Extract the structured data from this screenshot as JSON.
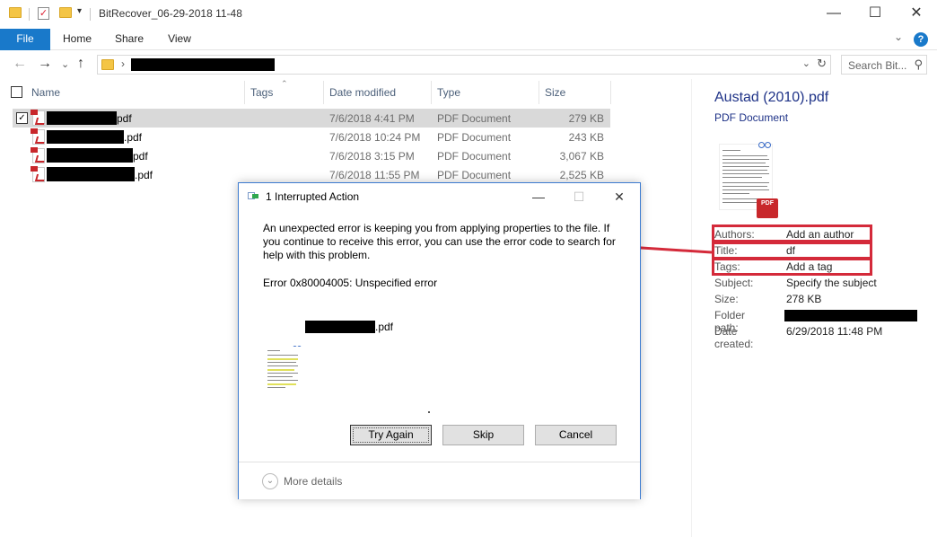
{
  "window": {
    "title": "BitRecover_06-29-2018 11-48",
    "minimize": "—",
    "maximize": "☐",
    "close": "✕"
  },
  "ribbon": {
    "tabs": [
      "File",
      "Home",
      "Share",
      "View"
    ],
    "help": "?",
    "collapse": "⌄"
  },
  "nav": {
    "back": "←",
    "forward": "→",
    "recent": "⌄",
    "up": "↑",
    "breadcrumb_sep": "›",
    "dropdown": "⌄",
    "refresh": "↻",
    "search_placeholder": "Search Bit...",
    "search_icon": "⚲"
  },
  "columns": {
    "name": "Name",
    "tags": "Tags",
    "date": "Date modified",
    "type": "Type",
    "size": "Size",
    "sort_indicator": "⌃"
  },
  "files": [
    {
      "ext": "pdf",
      "date": "7/6/2018 4:41 PM",
      "type": "PDF Document",
      "size": "279 KB",
      "selected": true
    },
    {
      "ext": ".pdf",
      "date": "7/6/2018 10:24 PM",
      "type": "PDF Document",
      "size": "243 KB",
      "selected": false
    },
    {
      "ext": "pdf",
      "date": "7/6/2018 3:15 PM",
      "type": "PDF Document",
      "size": "3,067 KB",
      "selected": false
    },
    {
      "ext": ".pdf",
      "date": "7/6/2018 11:55 PM",
      "type": "PDF Document",
      "size": "2,525 KB",
      "selected": false
    }
  ],
  "details": {
    "title": "Austad (2010).pdf",
    "type": "PDF Document",
    "badge": "PDF",
    "authors_label": "Authors:",
    "authors_value": "Add an author",
    "title_label": "Title:",
    "title_value": "df",
    "tags_label": "Tags:",
    "tags_value": "Add a tag",
    "subject_label": "Subject:",
    "subject_value": "Specify the subject",
    "size_label": "Size:",
    "size_value": "278 KB",
    "folder_label": "Folder path:",
    "created_label": "Date created:",
    "created_value": "6/29/2018 11:48 PM",
    "highlight_color": "#d42a3a"
  },
  "dialog": {
    "title": "1 Interrupted Action",
    "minimize": "—",
    "maximize": "☐",
    "close": "✕",
    "message": "An unexpected error is keeping you from applying properties to the file. If you continue to receive this error, you can use the error code to search for help with this problem.",
    "error": "Error 0x80004005: Unspecified error",
    "file_ext": ".pdf",
    "buttons": {
      "try_again": "Try Again",
      "skip": "Skip",
      "cancel": "Cancel"
    },
    "more_details": "More details",
    "more_icon": "⌄"
  },
  "colors": {
    "accent": "#1979ca",
    "header_text": "#4c607a",
    "details_title": "#1e3287",
    "dialog_border": "#3c7bd0"
  }
}
